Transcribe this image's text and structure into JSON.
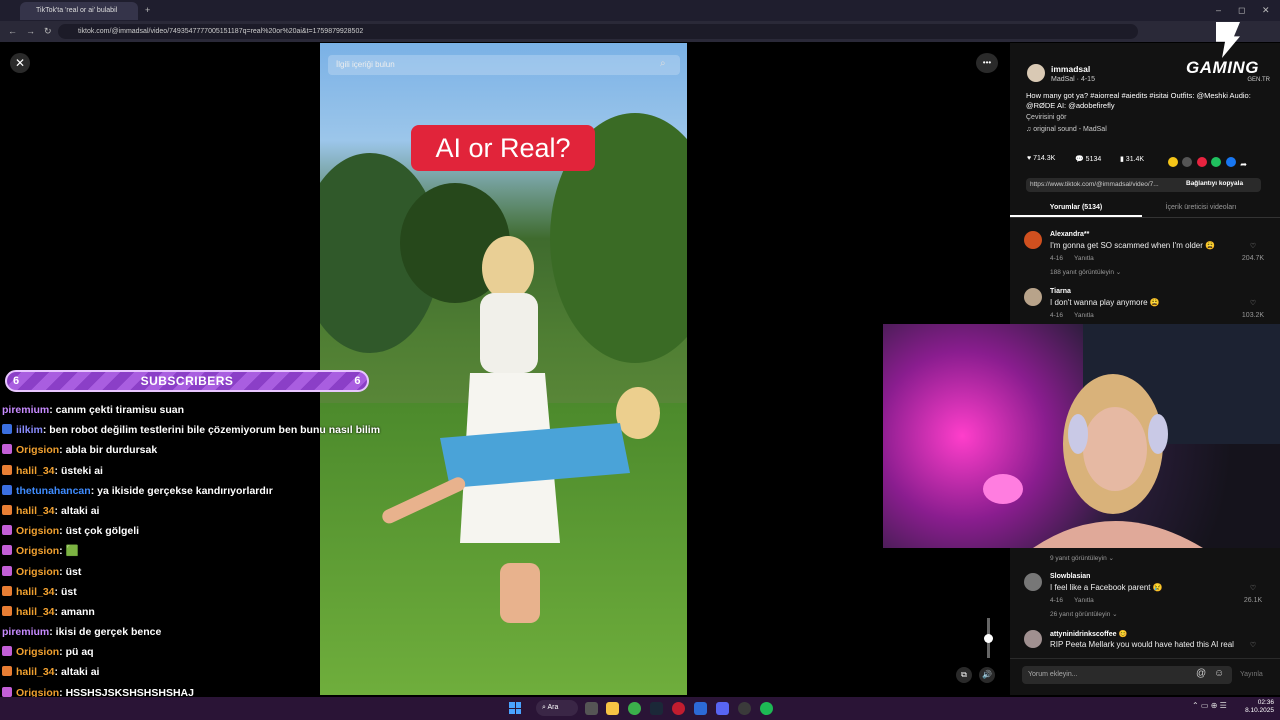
{
  "browser": {
    "tab_title": "TikTok'ta 'real or ai' bulabil",
    "new_tab": "+",
    "url": "tiktok.com/@immadsal/video/7493547777005151187q=real%20or%20ai&t=1759879928502",
    "window_controls": [
      "–",
      "◻",
      "✕"
    ]
  },
  "video": {
    "search_placeholder": "İlgili içeriği bulun",
    "overlay_text": "AI or Real?",
    "close": "✕",
    "more": "•••"
  },
  "post": {
    "username": "immadsal",
    "subline": "MadSal · 4-15",
    "caption": "How many got ya? #aiorreal #aiedits #isitai Outfits: @Meshki Audio: @RØDE AI: @adobefirefly",
    "translate": "Çevirisini gör",
    "sound": "original sound - MadSal",
    "likes": "714.3K",
    "comments": "5134",
    "saves": "31.4K",
    "link": "https://www.tiktok.com/@immadsal/video/7...",
    "copy_link": "Bağlantıyı kopyala",
    "tab_comments": "Yorumlar (5134)",
    "tab_creator": "İçerik üreticisi videoları"
  },
  "comments": [
    {
      "name": "Alexandra**",
      "text": "I'm gonna get SO scammed when I'm older 😩",
      "date": "4-16",
      "reply": "Yanıtla",
      "likes": "204.7K",
      "replies": "188 yanıt görüntüleyin ⌄"
    },
    {
      "name": "Tiarna",
      "text": "I don't wanna play anymore 😩",
      "date": "4-16",
      "reply": "Yanıtla",
      "likes": "103.2K",
      "replies": "9 yanıt görüntüleyin ⌄"
    },
    {
      "name": "Slowblasian",
      "text": "I feel like a Facebook parent 😢",
      "date": "4-16",
      "reply": "Yanıtla",
      "likes": "26.1K",
      "replies": "26 yanıt görüntüleyin ⌄"
    },
    {
      "name": "attyninidrinkscoffee 😊",
      "text": "RIP Peeta Mellark you would have hated this AI real",
      "date": "",
      "reply": "",
      "likes": "",
      "replies": ""
    }
  ],
  "comment_input": {
    "placeholder": "Yorum ekleyin...",
    "post": "Yayınla"
  },
  "logo": {
    "main": "GAMING",
    "sub": "GEN.TR"
  },
  "subscribers": {
    "label": "SUBSCRIBERS",
    "left": "6",
    "right": "6"
  },
  "chat": [
    {
      "user": "piremium",
      "msg": ": canım çekti tiramisu suan",
      "color": "#c78bff",
      "badge": "none"
    },
    {
      "user": "iilkim",
      "msg": ": ben robot değilim testlerini bile çözemiyorum ben bunu nasıl bilim",
      "color": "#8a8cff",
      "badge": "blue"
    },
    {
      "user": "Origsion",
      "msg": ": abla bir durdursak",
      "color": "#f0a030",
      "badge": "purple"
    },
    {
      "user": "halil_34",
      "msg": ": üsteki ai",
      "color": "#f0a030",
      "badge": "orange"
    },
    {
      "user": "thetunahancan",
      "msg": ": ya ikiside gerçekse kandırıyorlardır",
      "color": "#3f8cff",
      "badge": "blue"
    },
    {
      "user": "halil_34",
      "msg": ": altaki ai",
      "color": "#f0a030",
      "badge": "orange"
    },
    {
      "user": "Origsion",
      "msg": ": üst çok gölgeli",
      "color": "#f0a030",
      "badge": "purple"
    },
    {
      "user": "Origsion",
      "msg": ": 🟩",
      "color": "#f0a030",
      "badge": "purple"
    },
    {
      "user": "Origsion",
      "msg": ": üst",
      "color": "#f0a030",
      "badge": "purple"
    },
    {
      "user": "halil_34",
      "msg": ": üst",
      "color": "#f0a030",
      "badge": "orange"
    },
    {
      "user": "halil_34",
      "msg": ": amann",
      "color": "#f0a030",
      "badge": "orange"
    },
    {
      "user": "piremium",
      "msg": ": ikisi de gerçek bence",
      "color": "#c78bff",
      "badge": "none"
    },
    {
      "user": "Origsion",
      "msg": ": pü aq",
      "color": "#f0a030",
      "badge": "purple"
    },
    {
      "user": "halil_34",
      "msg": ": altaki ai",
      "color": "#f0a030",
      "badge": "orange"
    },
    {
      "user": "Origsion",
      "msg": ": HSSHSJSKSHSHSHSHAJ",
      "color": "#f0a030",
      "badge": "purple"
    }
  ],
  "taskbar": {
    "search": "Ara",
    "time": "02:36",
    "date": "8.10.2025"
  }
}
